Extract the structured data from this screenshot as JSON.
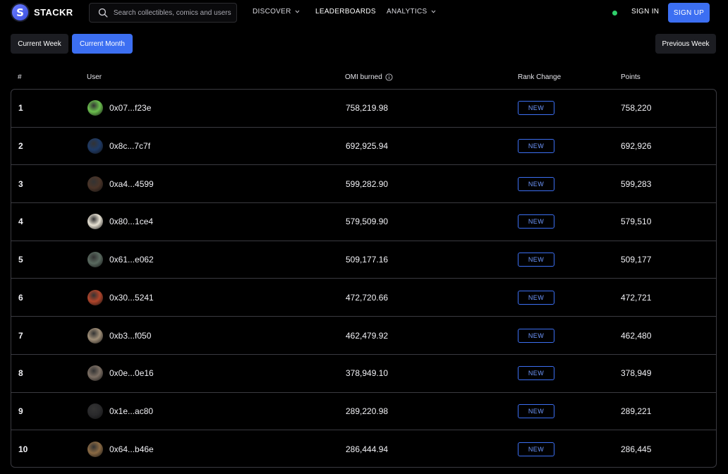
{
  "brand": {
    "name": "STACKR",
    "mark": "S"
  },
  "search": {
    "placeholder": "Search collectibles, comics and users"
  },
  "nav": {
    "discover": "DISCOVER",
    "leaderboards": "LEADERBOARDS",
    "analytics": "ANALYTICS",
    "sign_in": "SIGN IN",
    "sign_up": "SIGN UP"
  },
  "filters": {
    "current_week": "Current Week",
    "current_month": "Current Month",
    "previous_week": "Previous Week"
  },
  "table": {
    "headers": {
      "rank": "#",
      "user": "User",
      "omi": "OMI burned",
      "rank_change": "Rank Change",
      "points": "Points"
    },
    "rows": [
      {
        "rank": "1",
        "user": "0x07...f23e",
        "omi": "758,219.98",
        "change": "NEW",
        "points": "758,220",
        "avatar_color": "#6bbf4e"
      },
      {
        "rank": "2",
        "user": "0x8c...7c7f",
        "omi": "692,925.94",
        "change": "NEW",
        "points": "692,926",
        "avatar_color": "#1e3a66"
      },
      {
        "rank": "3",
        "user": "0xa4...4599",
        "omi": "599,282.90",
        "change": "NEW",
        "points": "599,283",
        "avatar_color": "#4a3428"
      },
      {
        "rank": "4",
        "user": "0x80...1ce4",
        "omi": "579,509.90",
        "change": "NEW",
        "points": "579,510",
        "avatar_color": "#e8e2d4"
      },
      {
        "rank": "5",
        "user": "0x61...e062",
        "omi": "509,177.16",
        "change": "NEW",
        "points": "509,177",
        "avatar_color": "#5a6a60"
      },
      {
        "rank": "6",
        "user": "0x30...5241",
        "omi": "472,720.66",
        "change": "NEW",
        "points": "472,721",
        "avatar_color": "#b0442a"
      },
      {
        "rank": "7",
        "user": "0xb3...f050",
        "omi": "462,479.92",
        "change": "NEW",
        "points": "462,480",
        "avatar_color": "#a08f78"
      },
      {
        "rank": "8",
        "user": "0x0e...0e16",
        "omi": "378,949.10",
        "change": "NEW",
        "points": "378,949",
        "avatar_color": "#7c6f64"
      },
      {
        "rank": "9",
        "user": "0x1e...ac80",
        "omi": "289,220.98",
        "change": "NEW",
        "points": "289,221",
        "avatar_color": "#2a2a2c"
      },
      {
        "rank": "10",
        "user": "0x64...b46e",
        "omi": "286,444.94",
        "change": "NEW",
        "points": "286,445",
        "avatar_color": "#8a6a44"
      }
    ]
  },
  "colors": {
    "accent": "#3c6ff2",
    "status": "#2fd06b",
    "background": "#000000",
    "border": "#3a3a40"
  }
}
